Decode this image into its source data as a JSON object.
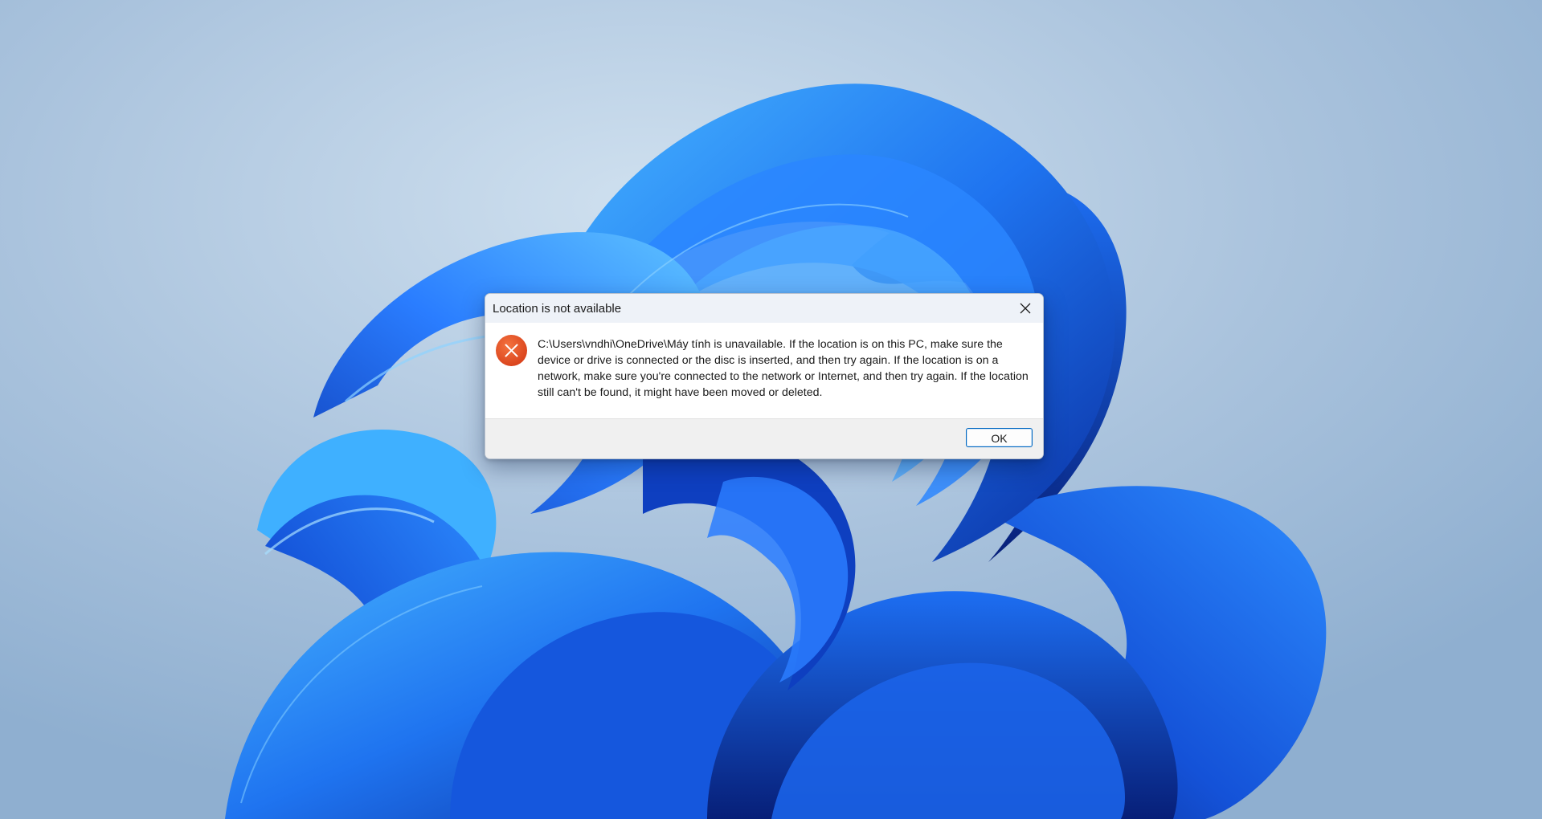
{
  "desktop": {
    "wallpaper": "windows-11-bloom"
  },
  "dialog": {
    "title": "Location is not available",
    "close_icon": "close-icon",
    "status_icon": "error-x-icon",
    "message": "C:\\Users\\vndhi\\OneDrive\\Máy tính is unavailable. If the location is on this PC, make sure the device or drive is connected or the disc is inserted, and then try again. If the location is on a network, make sure you're connected to the network or Internet, and then try again. If the location still can't be found, it might have been moved or deleted.",
    "ok_label": "OK"
  },
  "colors": {
    "accent": "#0067c0",
    "error": "#e2461f",
    "bloom_light": "#3aa0ff",
    "bloom_dark": "#0a2f9e"
  }
}
